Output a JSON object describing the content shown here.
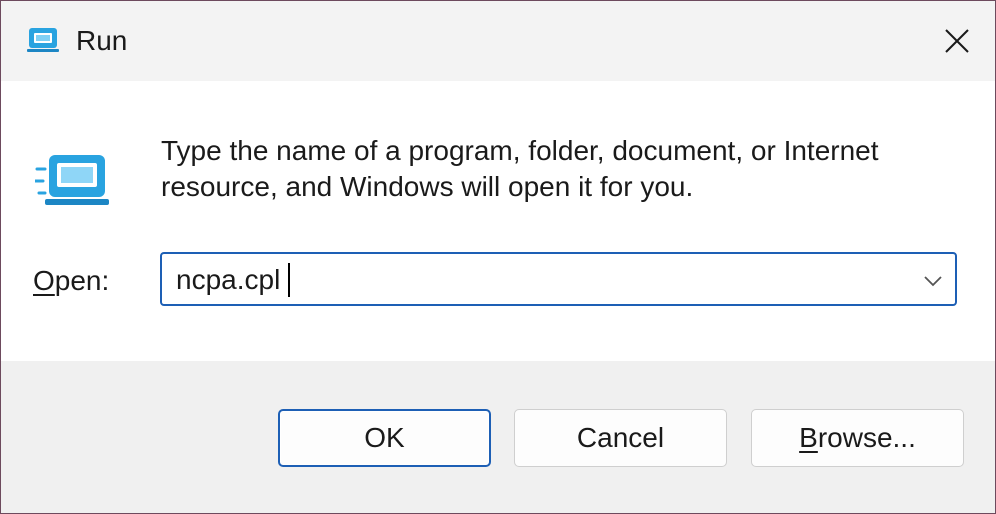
{
  "window": {
    "title": "Run",
    "icon": "run-icon",
    "close_icon": "close-icon"
  },
  "content": {
    "description": "Type the name of a program, folder, document, or Internet resource, and Windows will open it for you.",
    "open_label_accesskey": "O",
    "open_label_rest": "pen:",
    "open_value": "ncpa.cpl",
    "dropdown_icon": "chevron-down-icon"
  },
  "buttons": {
    "ok_label": "OK",
    "cancel_label": "Cancel",
    "browse_accesskey": "B",
    "browse_rest": "rowse..."
  },
  "colors": {
    "accent": "#1d5fb5",
    "icon_blue": "#29a3e0",
    "content_bg": "#ffffff",
    "footer_bg": "#f0f0f0"
  }
}
